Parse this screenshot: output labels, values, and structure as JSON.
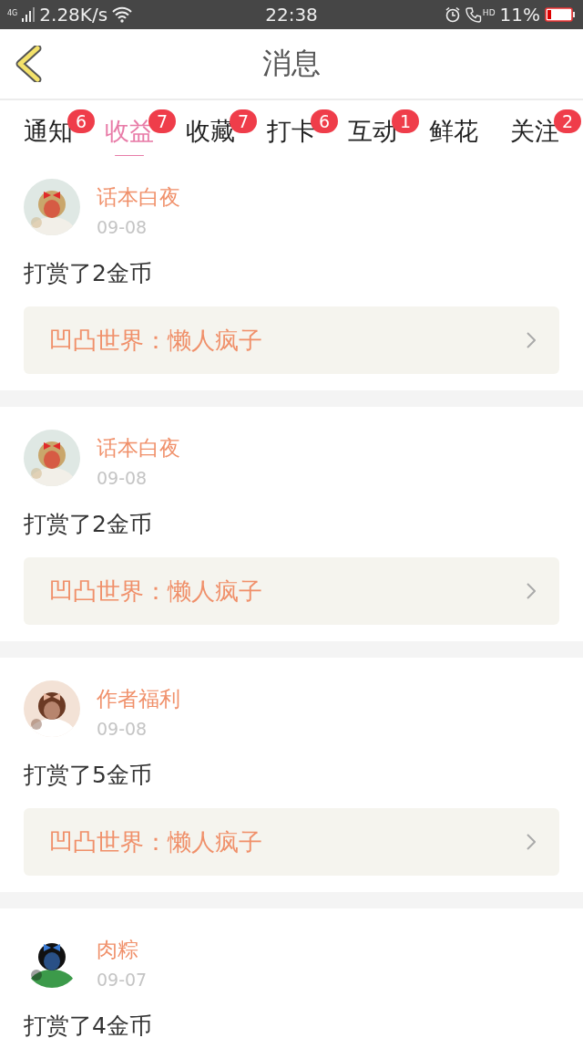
{
  "status_bar": {
    "network": "4G",
    "speed": "2.28K/s",
    "time": "22:38",
    "call_badge": "HD",
    "battery": "11%"
  },
  "header": {
    "title": "消息"
  },
  "tabs": [
    {
      "label": "通知",
      "badge": "6",
      "selected": false
    },
    {
      "label": "收益",
      "badge": "7",
      "selected": true
    },
    {
      "label": "收藏",
      "badge": "7",
      "selected": false
    },
    {
      "label": "打卡",
      "badge": "6",
      "selected": false
    },
    {
      "label": "互动",
      "badge": "1",
      "selected": false
    },
    {
      "label": "鲜花",
      "selected": false
    },
    {
      "label": "关注",
      "badge": "2",
      "selected": false
    }
  ],
  "messages": [
    {
      "user": "话本白夜",
      "date": "09-08",
      "text": "打赏了2金币",
      "link": "凹凸世界：懒人疯子"
    },
    {
      "user": "话本白夜",
      "date": "09-08",
      "text": "打赏了2金币",
      "link": "凹凸世界：懒人疯子"
    },
    {
      "user": "作者福利",
      "date": "09-08",
      "text": "打赏了5金币",
      "link": "凹凸世界：懒人疯子"
    },
    {
      "user": "肉粽",
      "date": "09-07",
      "text": "打赏了4金币"
    }
  ]
}
